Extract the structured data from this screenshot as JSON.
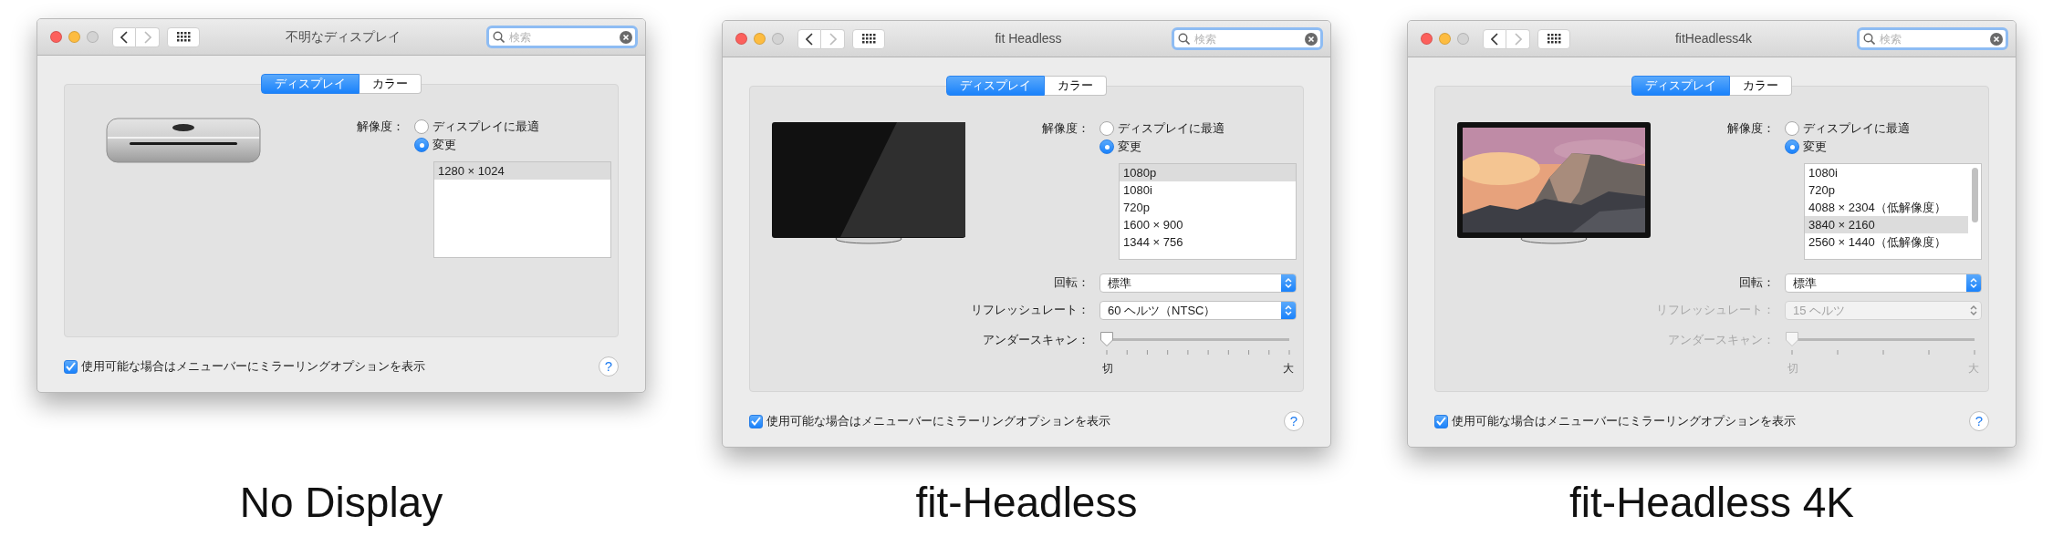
{
  "windows": [
    {
      "title": "不明なディスプレイ",
      "search": {
        "placeholder": "検索"
      },
      "tabs": [
        {
          "label": "ディスプレイ",
          "selected": true
        },
        {
          "label": "カラー",
          "selected": false
        }
      ],
      "device": {
        "kind": "mini-computer"
      },
      "resolution": {
        "label": "解像度：",
        "options": [
          {
            "label": "ディスプレイに最適",
            "selected": false
          },
          {
            "label": "変更",
            "selected": true
          }
        ],
        "list": [
          {
            "label": "1280 × 1024",
            "selected": true
          }
        ]
      },
      "mirror_option": {
        "label": "使用可能な場合はメニューバーにミラーリングオプションを表示",
        "checked": true
      },
      "help": "?"
    },
    {
      "title": "fit Headless",
      "search": {
        "placeholder": "検索"
      },
      "tabs": [
        {
          "label": "ディスプレイ",
          "selected": true
        },
        {
          "label": "カラー",
          "selected": false
        }
      ],
      "device": {
        "kind": "blank-display"
      },
      "resolution": {
        "label": "解像度：",
        "options": [
          {
            "label": "ディスプレイに最適",
            "selected": false
          },
          {
            "label": "変更",
            "selected": true
          }
        ],
        "list": [
          {
            "label": "1080p",
            "selected": true
          },
          {
            "label": "1080i",
            "selected": false
          },
          {
            "label": "720p",
            "selected": false
          },
          {
            "label": "1600 × 900",
            "selected": false
          },
          {
            "label": "1344 × 756",
            "selected": false
          }
        ]
      },
      "rotation": {
        "label": "回転：",
        "value": "標準",
        "disabled": false
      },
      "refresh_rate": {
        "label": "リフレッシュレート：",
        "value": "60 ヘルツ（NTSC）",
        "disabled": false
      },
      "underscan": {
        "label": "アンダースキャン：",
        "min_label": "切",
        "max_label": "大",
        "level": 0,
        "disabled": false
      },
      "mirror_option": {
        "label": "使用可能な場合はメニューバーにミラーリングオプションを表示",
        "checked": true
      },
      "help": "?"
    },
    {
      "title": "fitHeadless4k",
      "search": {
        "placeholder": "検索"
      },
      "tabs": [
        {
          "label": "ディスプレイ",
          "selected": true
        },
        {
          "label": "カラー",
          "selected": false
        }
      ],
      "device": {
        "kind": "display-with-picture"
      },
      "resolution": {
        "label": "解像度：",
        "options": [
          {
            "label": "ディスプレイに最適",
            "selected": false
          },
          {
            "label": "変更",
            "selected": true
          }
        ],
        "list": [
          {
            "label": "1080i",
            "selected": false
          },
          {
            "label": "720p",
            "selected": false
          },
          {
            "label": "4088 × 2304（低解像度）",
            "selected": false
          },
          {
            "label": "3840 × 2160",
            "selected": true
          },
          {
            "label": "2560 × 1440（低解像度）",
            "selected": false
          }
        ],
        "scrollable": true
      },
      "rotation": {
        "label": "回転：",
        "value": "標準",
        "disabled": false
      },
      "refresh_rate": {
        "label": "リフレッシュレート：",
        "value": "15 ヘルツ",
        "disabled": true
      },
      "underscan": {
        "label": "アンダースキャン：",
        "min_label": "切",
        "max_label": "大",
        "level": 0,
        "disabled": true
      },
      "mirror_option": {
        "label": "使用可能な場合はメニューバーにミラーリングオプションを表示",
        "checked": true
      },
      "help": "?"
    }
  ],
  "captions": [
    "No Display",
    "fit-Headless",
    "fit-Headless 4K"
  ]
}
